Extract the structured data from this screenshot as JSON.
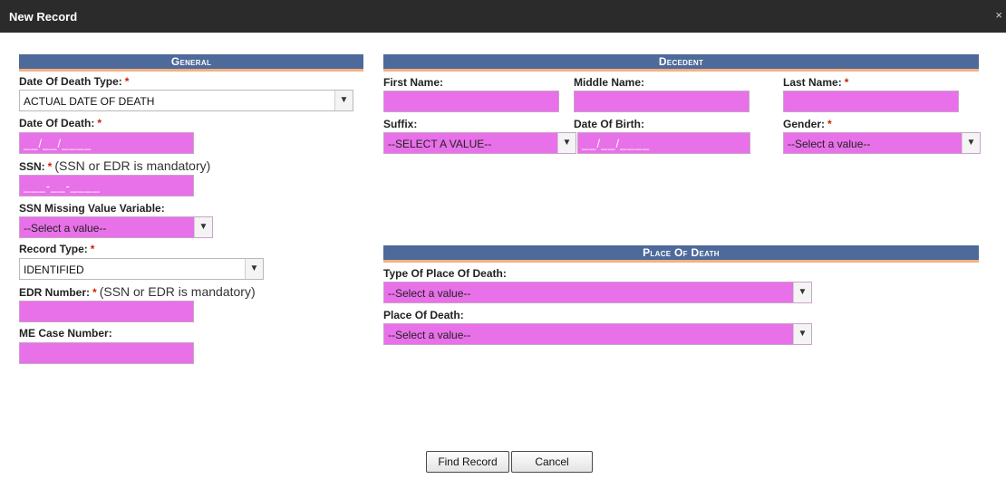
{
  "dialog": {
    "title": "New Record",
    "close_glyph": "×"
  },
  "general": {
    "header": "General",
    "date_of_death_type": {
      "label": "Date Of Death Type:",
      "required": "*",
      "value": "ACTUAL DATE OF DEATH"
    },
    "date_of_death": {
      "label": "Date Of Death:",
      "required": "*",
      "placeholder": "__/__/____"
    },
    "ssn": {
      "label": "SSN:",
      "required": "*",
      "note": "(SSN or EDR is mandatory)",
      "placeholder": "___-__-____"
    },
    "ssn_missing": {
      "label": "SSN Missing Value Variable:",
      "value": "--Select a value--"
    },
    "record_type": {
      "label": "Record Type:",
      "required": "*",
      "value": "IDENTIFIED"
    },
    "edr_number": {
      "label": "EDR Number:",
      "required": "*",
      "note": "(SSN or EDR is mandatory)"
    },
    "me_case_number": {
      "label": "ME Case Number:"
    }
  },
  "decedent": {
    "header": "Decedent",
    "first_name": {
      "label": "First Name:"
    },
    "middle_name": {
      "label": "Middle Name:"
    },
    "last_name": {
      "label": "Last Name:",
      "required": "*"
    },
    "suffix": {
      "label": "Suffix:",
      "value": "--SELECT A VALUE--"
    },
    "date_of_birth": {
      "label": "Date Of Birth:",
      "placeholder": "__/__/____"
    },
    "gender": {
      "label": "Gender:",
      "required": "*",
      "value": "--Select a value--"
    }
  },
  "place_of_death": {
    "header": "Place Of Death",
    "type": {
      "label": "Type Of Place Of Death:",
      "value": "--Select a value--"
    },
    "place": {
      "label": "Place Of Death:",
      "value": "--Select a value--"
    }
  },
  "buttons": {
    "find": "Find Record",
    "cancel": "Cancel"
  },
  "colors": {
    "field_pink": "#e870e8",
    "header_blue": "#4d6a9a",
    "header_underline": "#f3b182",
    "required_red": "#cc2200"
  },
  "icons": {
    "dropdown": "chevron-down-icon",
    "close": "close-icon"
  }
}
